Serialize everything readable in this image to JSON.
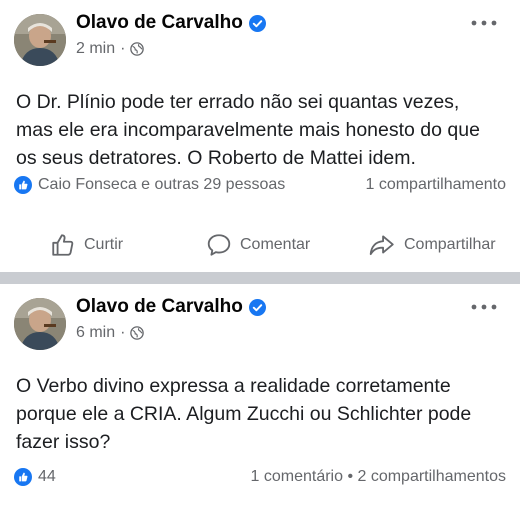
{
  "posts": [
    {
      "author": "Olavo de Carvalho",
      "time": "2 min",
      "dot": "·",
      "text": "O Dr. Plínio pode ter errado não sei quantas vezes, mas ele era incomparavelmente mais honesto do que os seus detratores. O Roberto de Mattei idem.",
      "reactions_text": "Caio Fonseca e outras 29 pessoas",
      "share_text": "1 compartilhamento",
      "actions": {
        "like": "Curtir",
        "comment": "Comentar",
        "share": "Compartilhar"
      }
    },
    {
      "author": "Olavo de Carvalho",
      "time": "6 min",
      "dot": "·",
      "text": "O Verbo divino expressa a realidade corretamente porque ele a CRIA. Algum Zucchi ou Schlichter pode fazer isso?",
      "reactions_text": "44",
      "share_text": "1 comentário • 2 compartilhamentos"
    }
  ],
  "colors": {
    "brand_blue": "#1877f2",
    "meta_gray": "#65676b",
    "separator": "#c9ccd1"
  },
  "icons": {
    "verified": "verified-badge-icon",
    "globe": "globe-icon",
    "more": "more-options-icon",
    "like": "like-icon",
    "comment": "comment-icon",
    "share": "share-icon"
  }
}
